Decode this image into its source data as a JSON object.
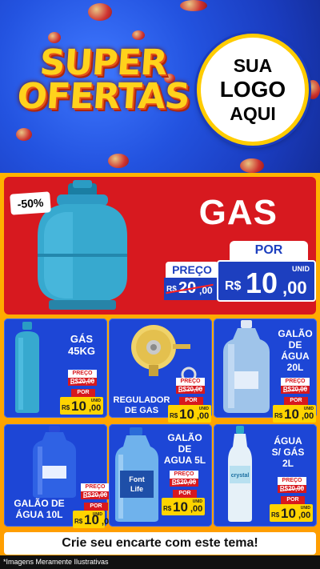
{
  "header": {
    "title_line1": "SUPER",
    "title_line2": "OFERTAS",
    "logo_line1": "SUA",
    "logo_line2": "LOGO",
    "logo_line3": "AQUI"
  },
  "featured": {
    "discount": "-50%",
    "title": "GAS",
    "por_label": "POR",
    "preco_label": "PREÇO",
    "old_currency": "R$",
    "old_int": "20",
    "old_cents": ",00",
    "unit": "UNID",
    "new_currency": "R$",
    "new_int": "10",
    "new_cents": ",00"
  },
  "products": [
    {
      "name_line1": "GÁS",
      "name_line2": "45KG",
      "name_line3": "",
      "preco_label": "PREÇO",
      "old_price": "R$20,00",
      "por_label": "POR",
      "unit": "UNID",
      "currency": "R$",
      "int": "10",
      "cents": ",00"
    },
    {
      "name_line1": "REGULADOR",
      "name_line2": "DE GAS",
      "name_line3": "",
      "preco_label": "PREÇO",
      "old_price": "R$20,00",
      "por_label": "POR",
      "unit": "UNID",
      "currency": "R$",
      "int": "10",
      "cents": ",00"
    },
    {
      "name_line1": "GALÃO",
      "name_line2": "DE",
      "name_line3": "ÁGUA",
      "name_line4": "20L",
      "preco_label": "PREÇO",
      "old_price": "R$20,00",
      "por_label": "POR",
      "unit": "UNID",
      "currency": "R$",
      "int": "10",
      "cents": ",00"
    },
    {
      "name_line1": "GALÃO DE",
      "name_line2": "ÁGUA 10L",
      "name_line3": "",
      "preco_label": "PREÇO",
      "old_price": "R$20,00",
      "por_label": "POR",
      "unit": "UNID",
      "currency": "R$",
      "int": "10",
      "cents": ",00"
    },
    {
      "name_line1": "GALÃO",
      "name_line2": "DE",
      "name_line3": "AGUA 5L",
      "preco_label": "PREÇO",
      "old_price": "R$20,00",
      "por_label": "POR",
      "unit": "UNID",
      "currency": "R$",
      "int": "10",
      "cents": ",00"
    },
    {
      "name_line1": "ÁGUA",
      "name_line2": "S/ GÁS",
      "name_line3": "2L",
      "preco_label": "PREÇO",
      "old_price": "R$20,00",
      "por_label": "POR",
      "unit": "UNID",
      "currency": "R$",
      "int": "10",
      "cents": ",00"
    }
  ],
  "product_labels": {
    "font_life": "Font Life",
    "crystal": "crystal"
  },
  "cta": "Crie seu encarte com este tema!",
  "footer_note": "*Imagens Meramente Ilustrativas",
  "colors": {
    "header_blue": "#2353e0",
    "title_yellow": "#ffd21c",
    "feature_red": "#d7191f",
    "card_blue": "#1d46d6",
    "price_yellow": "#ffd400",
    "background_orange": "#ffb300"
  }
}
